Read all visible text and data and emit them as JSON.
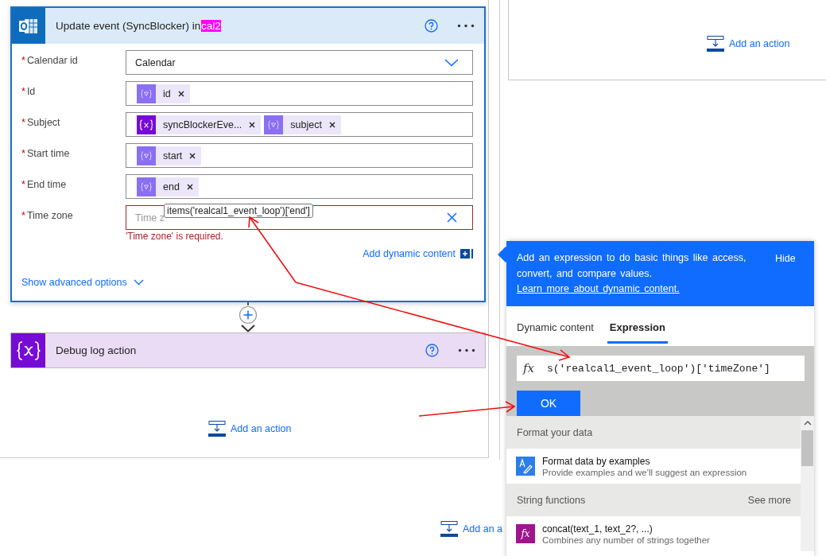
{
  "right_panel": {
    "add_action": "Add an action"
  },
  "card": {
    "title": "Update event (SyncBlocker) in",
    "title_highlight": "cal2",
    "required_mark": "*",
    "fields": [
      {
        "label": "Calendar id",
        "required": true,
        "kind": "dropdown",
        "value": "Calendar"
      },
      {
        "label": "Id",
        "required": true,
        "kind": "tokens",
        "tokens": [
          {
            "kind": "output",
            "text": "id"
          }
        ]
      },
      {
        "label": "Subject",
        "required": true,
        "kind": "tokens",
        "tokens": [
          {
            "kind": "variable",
            "text": "syncBlockerEve..."
          },
          {
            "kind": "output",
            "text": "subject"
          }
        ]
      },
      {
        "label": "Start time",
        "required": true,
        "kind": "tokens",
        "tokens": [
          {
            "kind": "output",
            "text": "start"
          }
        ]
      },
      {
        "label": "End time",
        "required": true,
        "kind": "tokens",
        "tokens": [
          {
            "kind": "output",
            "text": "end"
          }
        ]
      },
      {
        "label": "Time zone",
        "required": true,
        "kind": "text",
        "placeholder": "Time z",
        "invalid": true,
        "error": "'Time zone' is required.",
        "tooltip": "items('realcal1_event_loop')['end']"
      }
    ],
    "add_dynamic_content": "Add dynamic content",
    "show_advanced": "Show advanced options"
  },
  "next_action": {
    "title": "Debug log action"
  },
  "scope": {
    "add_action": "Add an action"
  },
  "bottom": {
    "add_action": "Add an a"
  },
  "popup": {
    "info": "Add an expression to do basic things like access, convert, and compare values.",
    "link": "Learn more about dynamic content.",
    "hide": "Hide",
    "tabs": [
      {
        "label": "Dynamic content",
        "selected": false
      },
      {
        "label": "Expression",
        "selected": true
      }
    ],
    "fx": "fx",
    "expression": "s('realcal1_event_loop')['timeZone']",
    "ok": "OK",
    "sections": [
      {
        "title": "Format your data",
        "items": [
          {
            "kind": "format",
            "name": "Format data by examples",
            "description": "Provide examples and we'll suggest an expression"
          }
        ]
      },
      {
        "title": "String functions",
        "more": "See more",
        "items": [
          {
            "kind": "function",
            "icon_text": "fx",
            "name": "concat(text_1, text_2?, ...)",
            "description": "Combines any number of strings together"
          }
        ]
      }
    ]
  }
}
